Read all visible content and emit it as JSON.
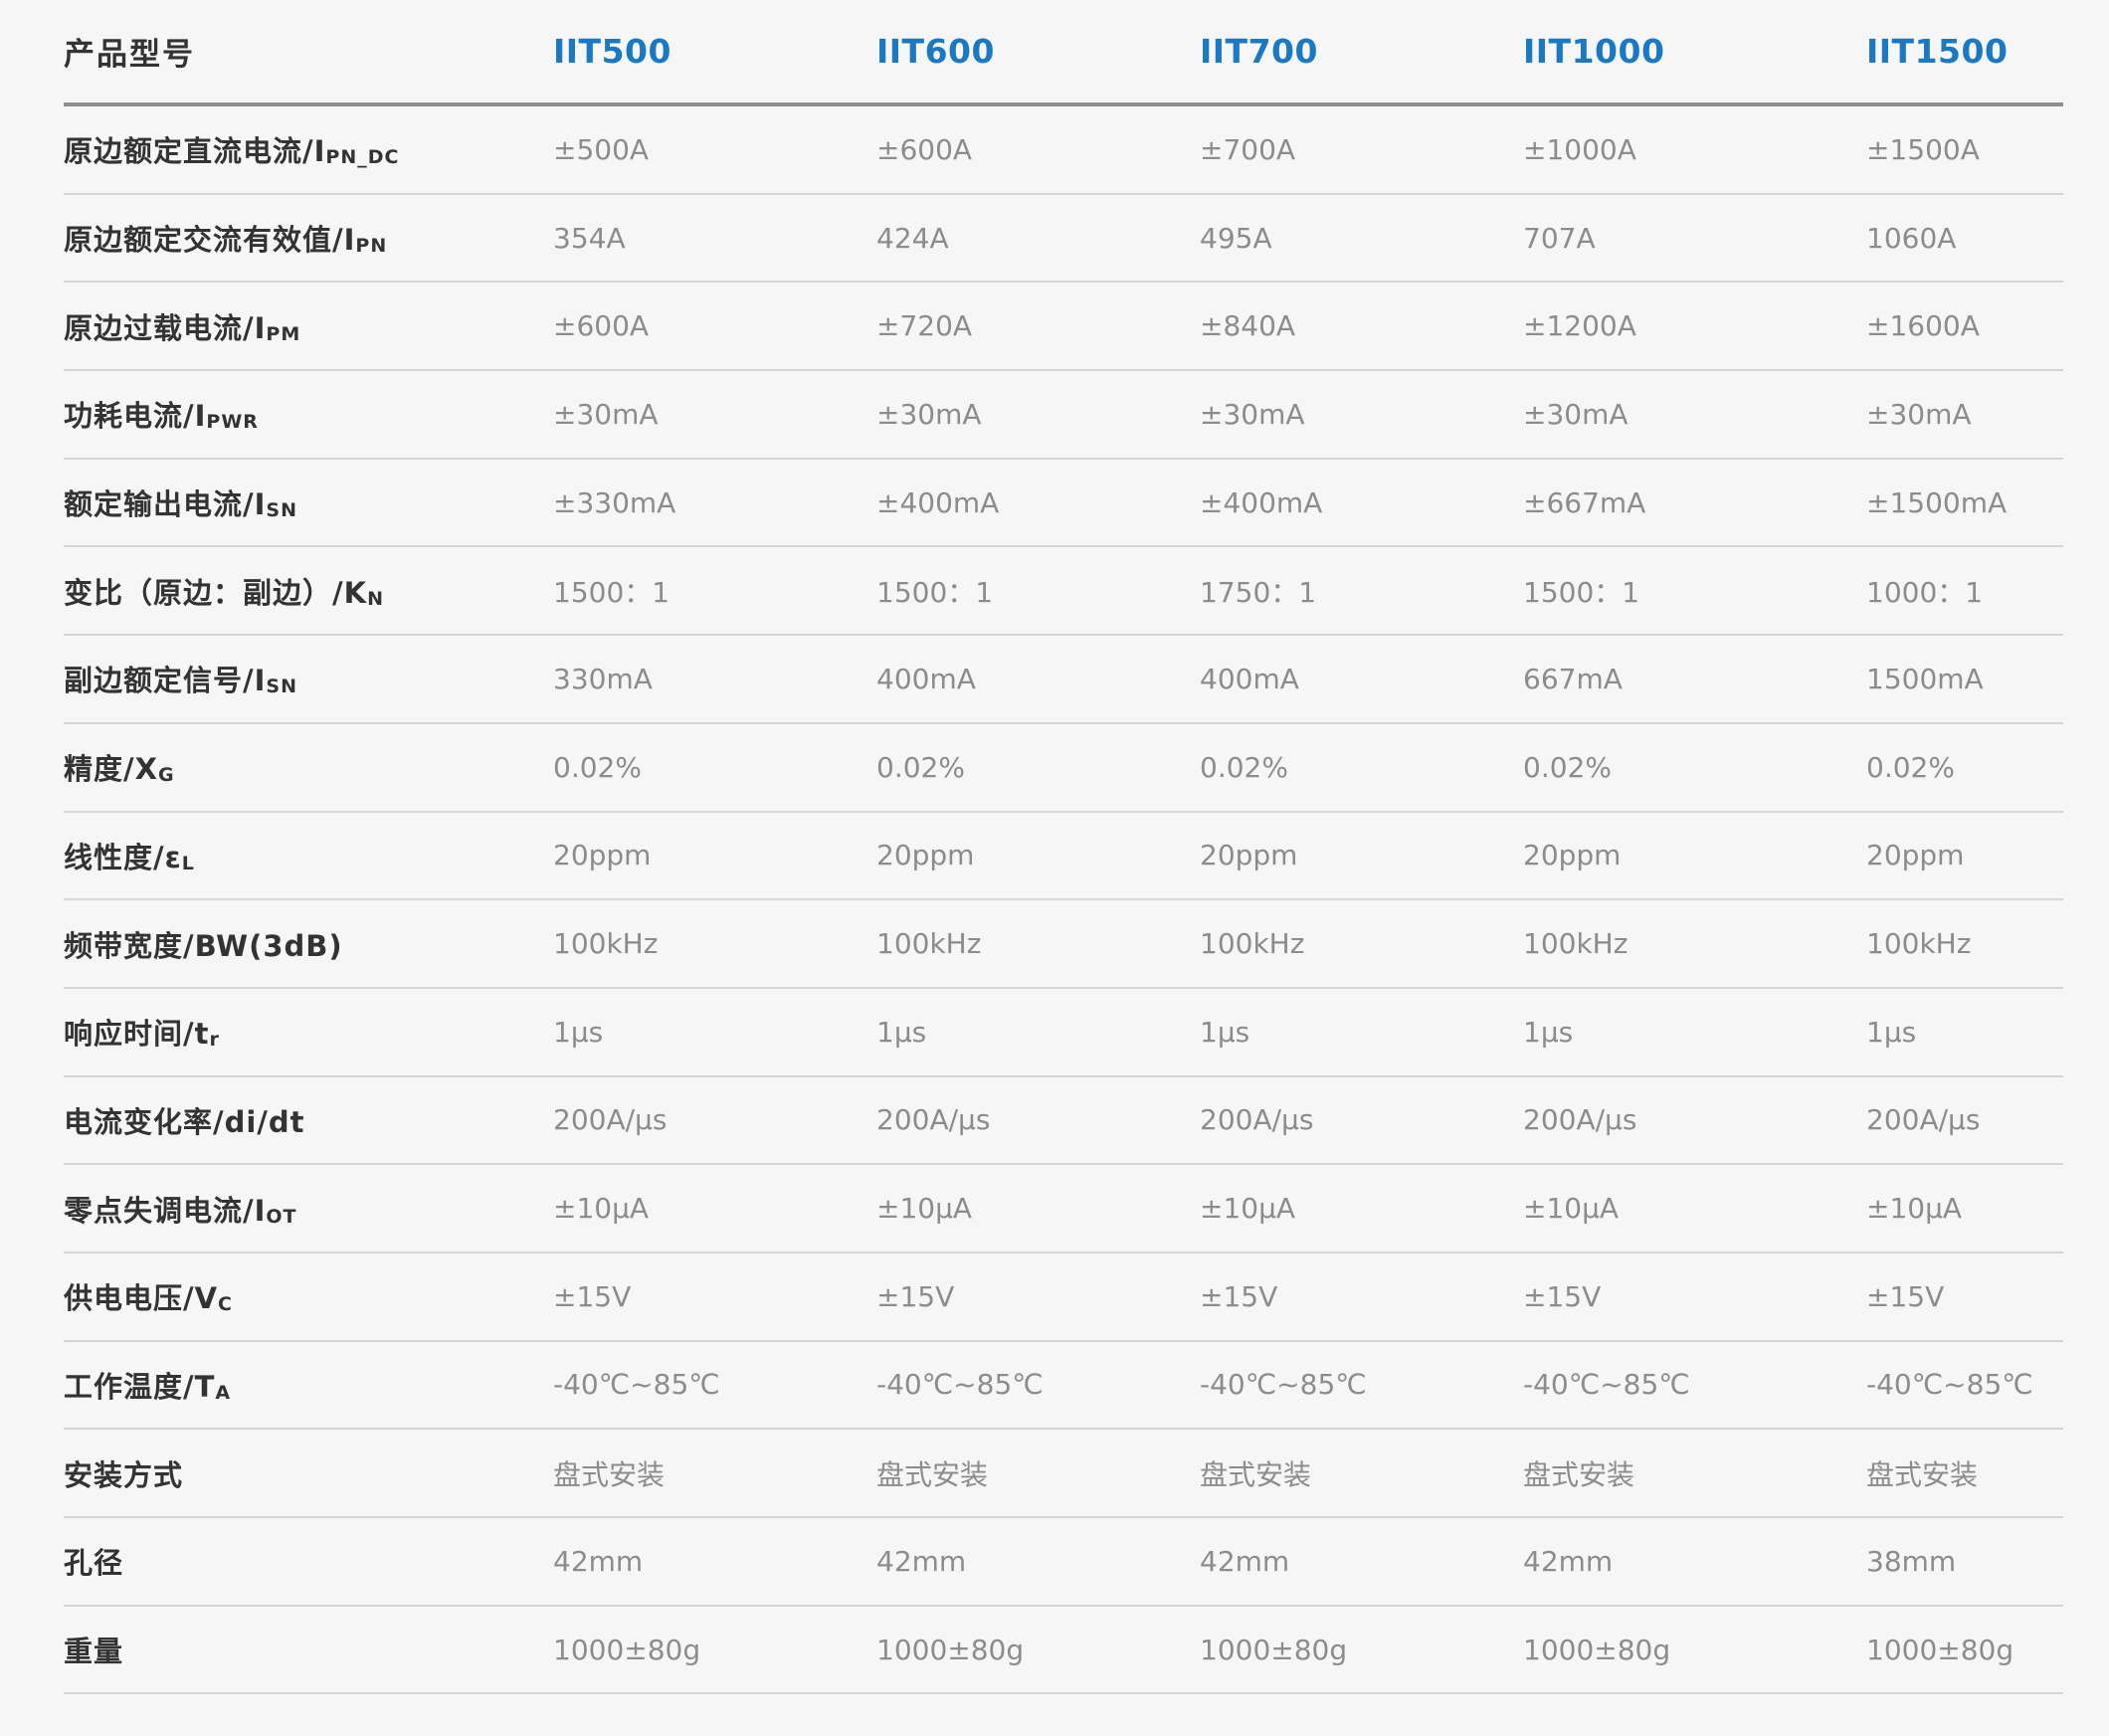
{
  "header": {
    "label": "产品型号",
    "models": [
      "IIT500",
      "IIT600",
      "IIT700",
      "IIT1000",
      "IIT1500"
    ]
  },
  "rows": [
    {
      "name": "原边额定直流电流/I",
      "sub": "PN_DC",
      "values": [
        "±500A",
        "±600A",
        "±700A",
        "±1000A",
        "±1500A"
      ]
    },
    {
      "name": "原边额定交流有效值/I",
      "sub": "PN",
      "values": [
        "354A",
        "424A",
        "495A",
        "707A",
        "1060A"
      ]
    },
    {
      "name": "原边过载电流/I",
      "sub": "PM",
      "values": [
        "±600A",
        "±720A",
        "±840A",
        "±1200A",
        "±1600A"
      ]
    },
    {
      "name": "功耗电流/I",
      "sub": "PWR",
      "values": [
        "±30mA",
        "±30mA",
        "±30mA",
        "±30mA",
        "±30mA"
      ]
    },
    {
      "name": "额定输出电流/I",
      "sub": "SN",
      "values": [
        "±330mA",
        "±400mA",
        "±400mA",
        "±667mA",
        "±1500mA"
      ]
    },
    {
      "name": "变比（原边：副边）/K",
      "sub": "N",
      "values": [
        "1500：1",
        "1500：1",
        "1750：1",
        "1500：1",
        "1000：1"
      ]
    },
    {
      "name": "副边额定信号/I",
      "sub": "SN",
      "values": [
        "330mA",
        "400mA",
        "400mA",
        "667mA",
        "1500mA"
      ]
    },
    {
      "name": "精度/X",
      "sub": "G",
      "values": [
        "0.02%",
        "0.02%",
        "0.02%",
        "0.02%",
        "0.02%"
      ]
    },
    {
      "name": "线性度/ε",
      "sub": "L",
      "values": [
        "20ppm",
        "20ppm",
        "20ppm",
        "20ppm",
        "20ppm"
      ]
    },
    {
      "name": "频带宽度/BW(3dB)",
      "sub": "",
      "values": [
        "100kHz",
        "100kHz",
        "100kHz",
        "100kHz",
        "100kHz"
      ]
    },
    {
      "name": "响应时间/t",
      "sub": "r",
      "values": [
        "1μs",
        "1μs",
        "1μs",
        "1μs",
        "1μs"
      ]
    },
    {
      "name": "电流变化率/di/dt",
      "sub": "",
      "values": [
        "200A/μs",
        "200A/μs",
        "200A/μs",
        "200A/μs",
        "200A/μs"
      ]
    },
    {
      "name": "零点失调电流/I",
      "sub": "OT",
      "values": [
        "±10μA",
        "±10μA",
        "±10μA",
        "±10μA",
        "±10μA"
      ]
    },
    {
      "name": "供电电压/V",
      "sub": "C",
      "values": [
        "±15V",
        "±15V",
        "±15V",
        "±15V",
        "±15V"
      ]
    },
    {
      "name": "工作温度/T",
      "sub": "A",
      "values": [
        " -40℃~85℃",
        " -40℃~85℃",
        " -40℃~85℃",
        " -40℃~85℃",
        " -40℃~85℃"
      ]
    },
    {
      "name": "安装方式",
      "sub": "",
      "values": [
        "盘式安装",
        "盘式安装",
        "盘式安装",
        "盘式安装",
        "盘式安装"
      ]
    },
    {
      "name": "孔径",
      "sub": "",
      "values": [
        "42mm",
        "42mm",
        "42mm",
        "42mm",
        "38mm"
      ]
    },
    {
      "name": "重量",
      "sub": "",
      "values": [
        "1000±80g",
        "1000±80g",
        "1000±80g",
        "1000±80g",
        "1000±80g"
      ]
    }
  ]
}
